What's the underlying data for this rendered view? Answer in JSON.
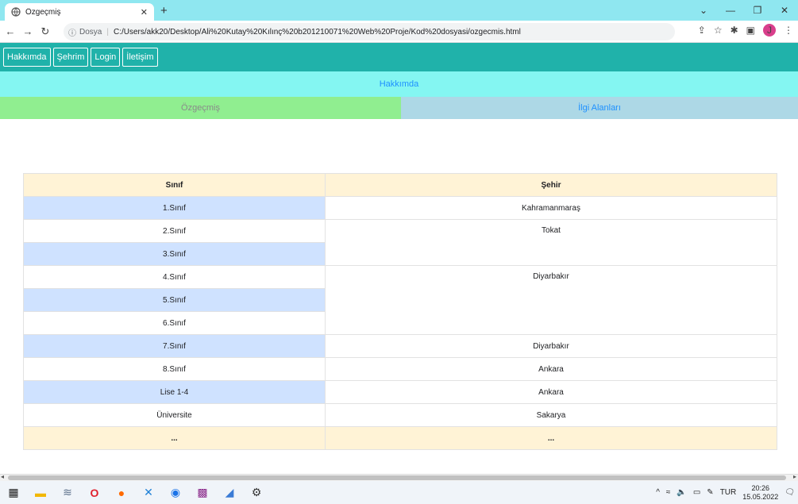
{
  "browser": {
    "tab_title": "Özgeçmiş",
    "url_prefix": "Dosya",
    "url": "C:/Users/akk20/Desktop/Ali%20Kutay%20Kılınç%20b201210071%20Web%20Proje/Kod%20dosyasi/ozgecmis.html",
    "profile_initial": "J"
  },
  "nav": {
    "items": [
      "Hakkımda",
      "Şehrim",
      "Login",
      "İletişim"
    ]
  },
  "hakkimda_bar": "Hakkımda",
  "tabs": {
    "left": "Özgeçmiş",
    "right": "İlgi Alanları"
  },
  "table": {
    "headers": [
      "Sınıf",
      "Şehir"
    ],
    "rows": [
      {
        "grade": "1.Sınıf",
        "city": "Kahramanmaraş"
      },
      {
        "grade": "2.Sınıf",
        "city": "Tokat"
      },
      {
        "grade": "3.Sınıf",
        "city": ""
      },
      {
        "grade": "4.Sınıf",
        "city": "Diyarbakır"
      },
      {
        "grade": "5.Sınıf",
        "city": ""
      },
      {
        "grade": "6.Sınıf",
        "city": ""
      },
      {
        "grade": "7.Sınıf",
        "city": "Diyarbakır"
      },
      {
        "grade": "8.Sınıf",
        "city": "Ankara"
      },
      {
        "grade": "Lise 1-4",
        "city": "Ankara"
      },
      {
        "grade": "Üniversite",
        "city": "Sakarya"
      }
    ],
    "footer": [
      "...",
      "..."
    ]
  },
  "tray": {
    "lang": "TUR",
    "time": "20:26",
    "date": "15.05.2022"
  },
  "colors": {
    "navbar": "#20b2aa",
    "hakkimda_bar": "#84f6f2",
    "tab_left": "#90ee90",
    "tab_right": "#add8e6",
    "row_blue": "#cfe2ff",
    "header_bg": "#fff3d6"
  }
}
